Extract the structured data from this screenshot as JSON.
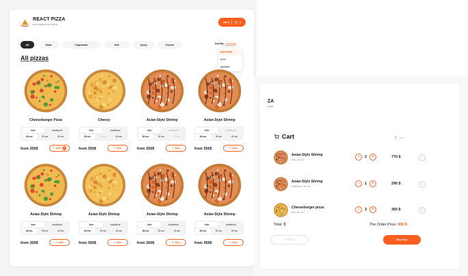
{
  "header": {
    "brand": "REACT PIZZA",
    "tagline": "best pizza of the world",
    "cart_price": "330 $",
    "cart_count": "3"
  },
  "categories": [
    "All",
    "Meat",
    "Vegetarian",
    "Grill",
    "Spicy",
    "Closed"
  ],
  "active_category": "All",
  "sort": {
    "label": "Sort By:",
    "current": "popularity",
    "options": [
      "popularity",
      "price",
      "alphabet"
    ]
  },
  "section_title": "All pizzas",
  "pizzas": [
    {
      "name": "Cheeseburger Pizza",
      "price": "from 350$",
      "add": "Add",
      "count": "2",
      "types": [
        "thin",
        "traditional"
      ],
      "sizes": [
        "26 cm.",
        "30 cm.",
        "40 cm."
      ]
    },
    {
      "name": "Cheesy",
      "price": "from 350$",
      "add": "Add",
      "types": [
        "thin",
        "traditional"
      ],
      "sizes": [
        "26 cm.",
        "30 cm.",
        "40 cm."
      ]
    },
    {
      "name": "Asian-Style Shrimp",
      "price": "from 350$",
      "add": "Add",
      "types": [
        "thin",
        "traditional"
      ],
      "sizes": [
        "26 cm.",
        "30 cm.",
        "40 cm."
      ]
    },
    {
      "name": "Asian-Style Shrimp",
      "price": "from 350$",
      "add": "Add",
      "types": [
        "thin",
        "traditional"
      ],
      "sizes": [
        "26 cm.",
        "30 cm.",
        "40 cm."
      ]
    },
    {
      "name": "Asian-Style Shrimp",
      "price": "from 350$",
      "add": "Add",
      "types": [
        "thin",
        "traditional"
      ],
      "sizes": [
        "26 cm.",
        "30 cm.",
        "40 cm."
      ]
    },
    {
      "name": "Asian-Style Shrimp",
      "price": "from 350$",
      "add": "Add",
      "types": [
        "thin",
        "traditional"
      ],
      "sizes": [
        "26 cm.",
        "30 cm.",
        "40 cm."
      ]
    },
    {
      "name": "Asian-Style Shrimp",
      "price": "from 350$",
      "add": "Add",
      "types": [
        "thin",
        "traditional"
      ],
      "sizes": [
        "26 cm.",
        "30 cm.",
        "40 cm."
      ]
    },
    {
      "name": "Asian-Style Shrimp",
      "price": "from 350$",
      "add": "Add",
      "types": [
        "thin",
        "traditional"
      ],
      "sizes": [
        "26 cm.",
        "30 cm.",
        "40 cm."
      ]
    }
  ],
  "cart_page": {
    "brand_fragment": "ZA",
    "tagline_fragment": "world",
    "title": "Cart",
    "clear": "clear",
    "items": [
      {
        "name": "Asian-Style Shrimp",
        "desc": "thin, 26 cm.",
        "qty": "2",
        "sum": "770 $"
      },
      {
        "name": "Asian-Style Shrimp",
        "desc": "traditional, 40 cm.",
        "qty": "1",
        "sum": "290 $"
      },
      {
        "name": "Cheeseburger pizza",
        "desc": "thin, 30 cm.",
        "qty": "3",
        "sum": "350 $"
      }
    ],
    "total_label": "Total:",
    "total_value": "3",
    "order_label": "The Order Price:",
    "order_value": "900 $",
    "back": "Go Back",
    "buy": "Buy Now"
  },
  "colors": {
    "accent": "#fe5f1e",
    "dark": "#282828",
    "chip": "#f5f5f5"
  }
}
